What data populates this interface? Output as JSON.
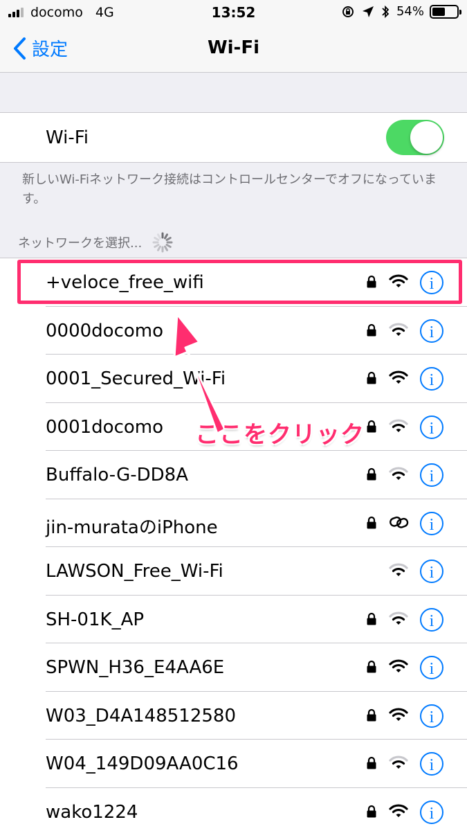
{
  "status_bar": {
    "carrier": "docomo",
    "network": "4G",
    "time": "13:52",
    "battery": "54%",
    "battery_level": 0.54,
    "icons": [
      "orientation-lock-icon",
      "location-icon",
      "bluetooth-icon"
    ]
  },
  "nav": {
    "back_label": "設定",
    "title": "Wi-Fi"
  },
  "wifi_toggle": {
    "label": "Wi-Fi",
    "on": true
  },
  "note": "新しいWi-Fiネットワーク接続はコントロールセンターでオフになっています。",
  "choose_network": "ネットワークを選択...",
  "networks": [
    {
      "name": "+veloce_free_wifi",
      "locked": true,
      "signal": "full"
    },
    {
      "name": "0000docomo",
      "locked": true,
      "signal": "weak"
    },
    {
      "name": "0001_Secured_Wi-Fi",
      "locked": true,
      "signal": "full"
    },
    {
      "name": "0001docomo",
      "locked": true,
      "signal": "weak"
    },
    {
      "name": "Buffalo-G-DD8A",
      "locked": true,
      "signal": "weak"
    },
    {
      "name": "jin-murataのiPhone",
      "locked": true,
      "signal": "hotspot"
    },
    {
      "name": "LAWSON_Free_Wi-Fi",
      "locked": false,
      "signal": "weak"
    },
    {
      "name": "SH-01K_AP",
      "locked": true,
      "signal": "weak"
    },
    {
      "name": "SPWN_H36_E4AA6E",
      "locked": true,
      "signal": "full"
    },
    {
      "name": "W03_D4A148512580",
      "locked": true,
      "signal": "full"
    },
    {
      "name": "W04_149D09AA0C16",
      "locked": true,
      "signal": "weak"
    },
    {
      "name": "wako1224",
      "locked": true,
      "signal": "full"
    }
  ],
  "annotation": {
    "callout": "ここをクリック",
    "color": "#ff2d6f"
  },
  "colors": {
    "accent": "#007aff",
    "toggle_on": "#4cd964"
  }
}
